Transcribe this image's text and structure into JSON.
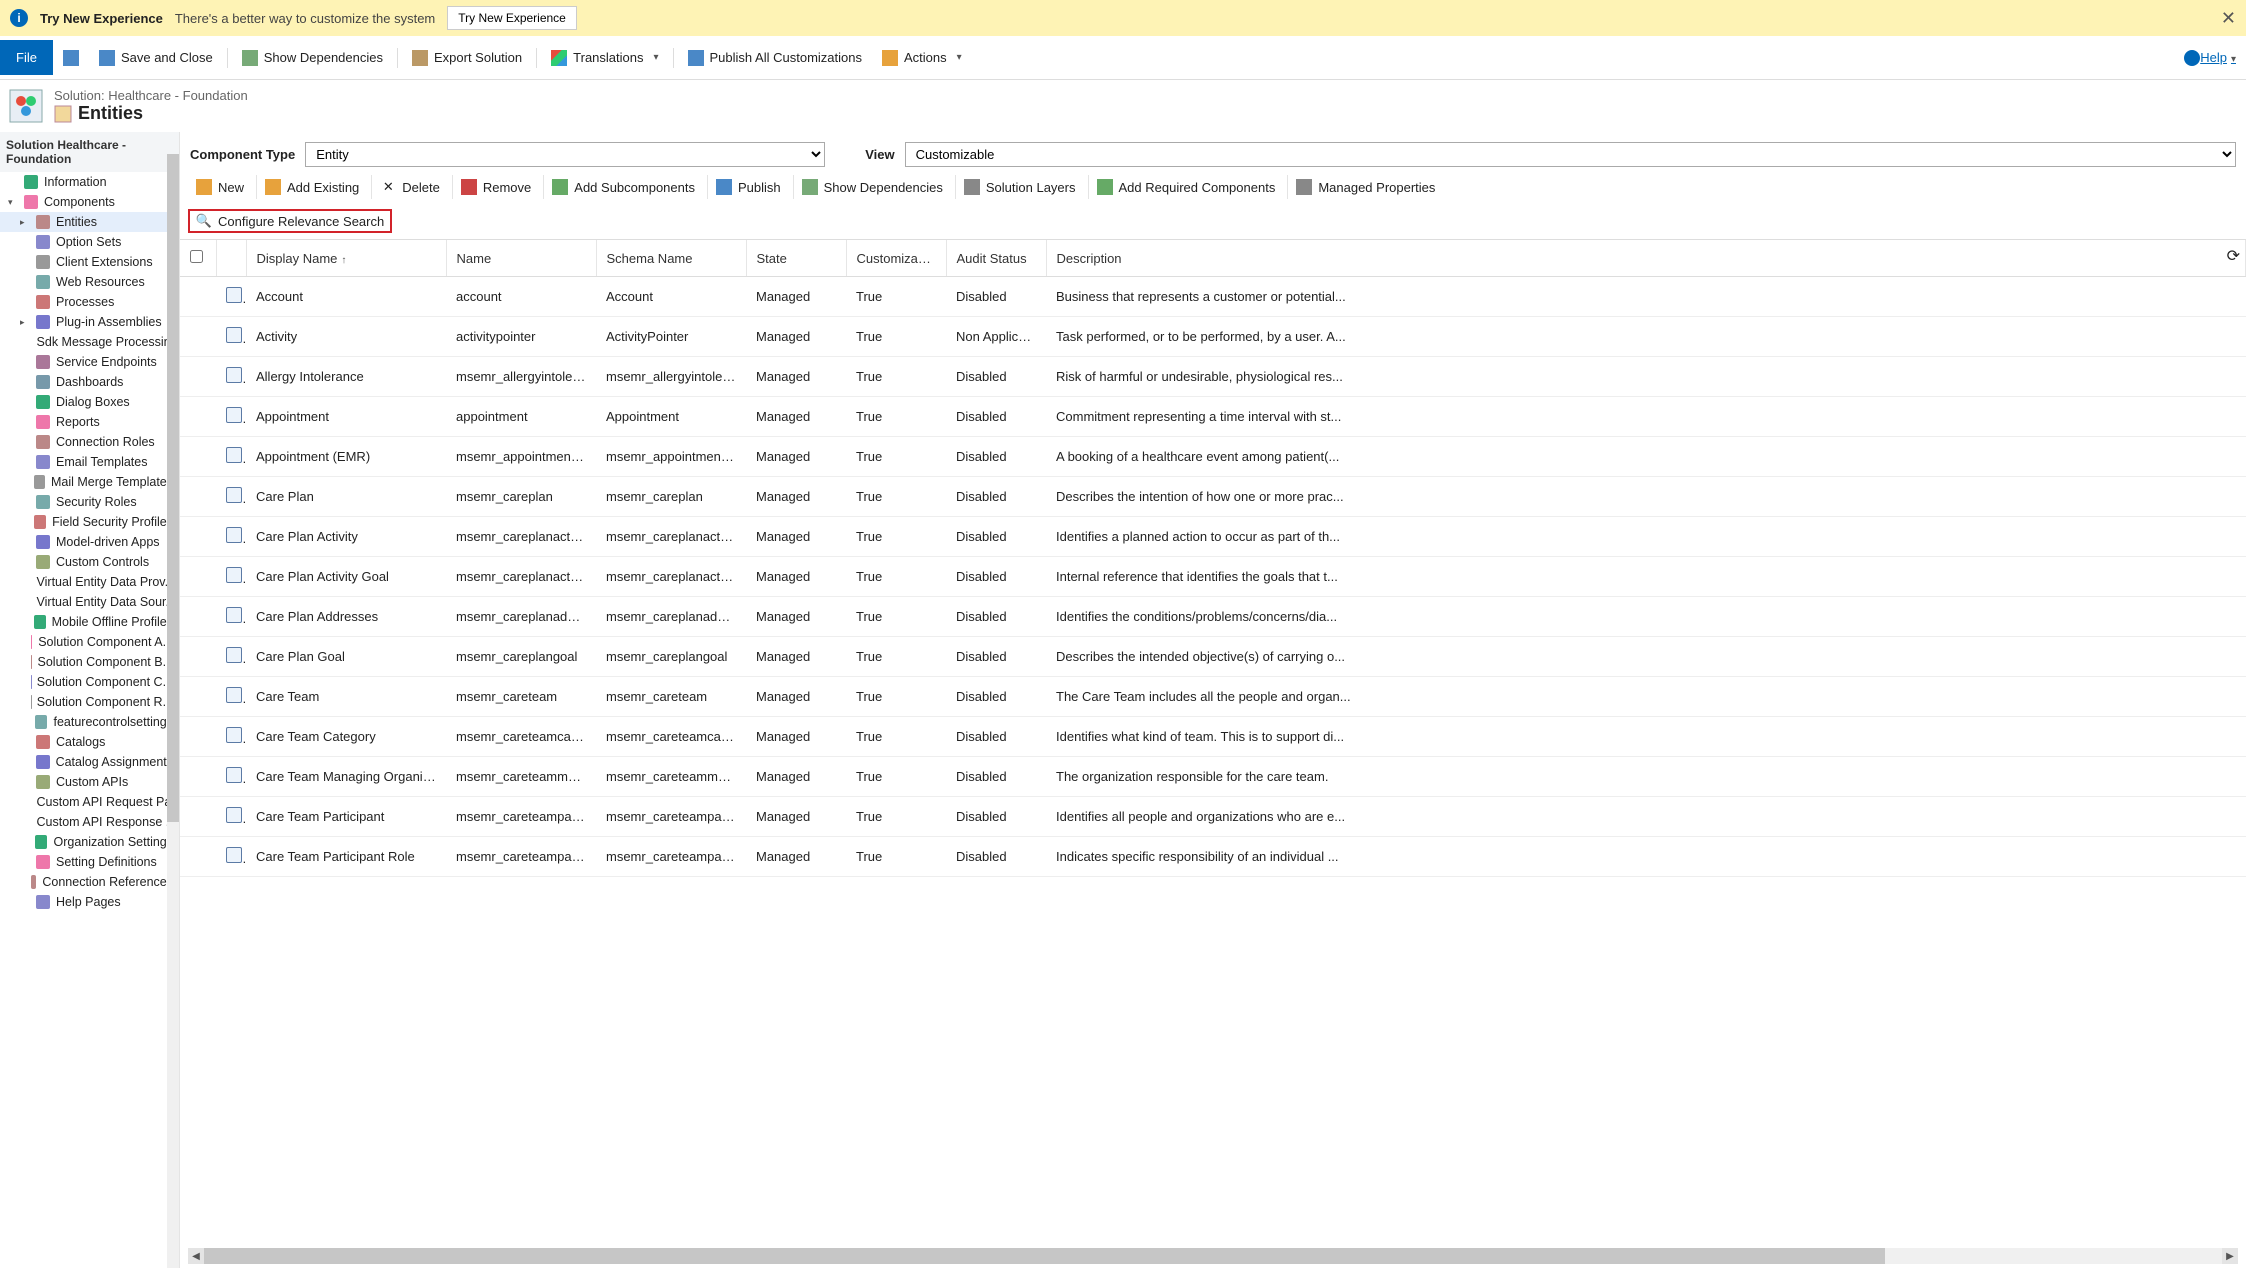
{
  "banner": {
    "title": "Try New Experience",
    "message": "There's a better way to customize the system",
    "button": "Try New Experience"
  },
  "ribbon": {
    "file": "File",
    "save": "",
    "save_close": "Save and Close",
    "show_deps": "Show Dependencies",
    "export_solution": "Export Solution",
    "translations": "Translations",
    "publish_all": "Publish All Customizations",
    "actions": "Actions",
    "help": "Help"
  },
  "header": {
    "solution_line": "Solution: Healthcare - Foundation",
    "entities": "Entities"
  },
  "sidebar": {
    "title": "Solution Healthcare - Foundation",
    "items": [
      {
        "label": "Information",
        "indent": 0,
        "twisty": ""
      },
      {
        "label": "Components",
        "indent": 0,
        "twisty": "▾"
      },
      {
        "label": "Entities",
        "indent": 1,
        "twisty": "▸",
        "sel": true
      },
      {
        "label": "Option Sets",
        "indent": 1,
        "twisty": ""
      },
      {
        "label": "Client Extensions",
        "indent": 1,
        "twisty": ""
      },
      {
        "label": "Web Resources",
        "indent": 1,
        "twisty": ""
      },
      {
        "label": "Processes",
        "indent": 1,
        "twisty": ""
      },
      {
        "label": "Plug-in Assemblies",
        "indent": 1,
        "twisty": "▸"
      },
      {
        "label": "Sdk Message Processin...",
        "indent": 1,
        "twisty": ""
      },
      {
        "label": "Service Endpoints",
        "indent": 1,
        "twisty": ""
      },
      {
        "label": "Dashboards",
        "indent": 1,
        "twisty": ""
      },
      {
        "label": "Dialog Boxes",
        "indent": 1,
        "twisty": ""
      },
      {
        "label": "Reports",
        "indent": 1,
        "twisty": ""
      },
      {
        "label": "Connection Roles",
        "indent": 1,
        "twisty": ""
      },
      {
        "label": "Email Templates",
        "indent": 1,
        "twisty": ""
      },
      {
        "label": "Mail Merge Templates",
        "indent": 1,
        "twisty": ""
      },
      {
        "label": "Security Roles",
        "indent": 1,
        "twisty": ""
      },
      {
        "label": "Field Security Profiles",
        "indent": 1,
        "twisty": ""
      },
      {
        "label": "Model-driven Apps",
        "indent": 1,
        "twisty": ""
      },
      {
        "label": "Custom Controls",
        "indent": 1,
        "twisty": ""
      },
      {
        "label": "Virtual Entity Data Prov...",
        "indent": 1,
        "twisty": ""
      },
      {
        "label": "Virtual Entity Data Sour...",
        "indent": 1,
        "twisty": ""
      },
      {
        "label": "Mobile Offline Profiles",
        "indent": 1,
        "twisty": ""
      },
      {
        "label": "Solution Component A...",
        "indent": 1,
        "twisty": ""
      },
      {
        "label": "Solution Component B...",
        "indent": 1,
        "twisty": ""
      },
      {
        "label": "Solution Component C...",
        "indent": 1,
        "twisty": ""
      },
      {
        "label": "Solution Component R...",
        "indent": 1,
        "twisty": ""
      },
      {
        "label": "featurecontrolsettings",
        "indent": 1,
        "twisty": ""
      },
      {
        "label": "Catalogs",
        "indent": 1,
        "twisty": ""
      },
      {
        "label": "Catalog Assignments",
        "indent": 1,
        "twisty": ""
      },
      {
        "label": "Custom APIs",
        "indent": 1,
        "twisty": ""
      },
      {
        "label": "Custom API Request Pa...",
        "indent": 1,
        "twisty": ""
      },
      {
        "label": "Custom API Response ...",
        "indent": 1,
        "twisty": ""
      },
      {
        "label": "Organization Settings",
        "indent": 1,
        "twisty": ""
      },
      {
        "label": "Setting Definitions",
        "indent": 1,
        "twisty": ""
      },
      {
        "label": "Connection References",
        "indent": 1,
        "twisty": ""
      },
      {
        "label": "Help Pages",
        "indent": 1,
        "twisty": ""
      }
    ]
  },
  "filters": {
    "component_type_label": "Component Type",
    "component_type_value": "Entity",
    "view_label": "View",
    "view_value": "Customizable"
  },
  "grid_toolbar": {
    "new": "New",
    "add_existing": "Add Existing",
    "delete": "Delete",
    "remove": "Remove",
    "add_subcomponents": "Add Subcomponents",
    "publish": "Publish",
    "show_deps": "Show Dependencies",
    "solution_layers": "Solution Layers",
    "add_required": "Add Required Components",
    "managed_props": "Managed Properties",
    "configure_relevance": "Configure Relevance Search"
  },
  "columns": {
    "display_name": "Display Name",
    "name": "Name",
    "schema_name": "Schema Name",
    "state": "State",
    "customizable": "Customizable...",
    "audit_status": "Audit Status",
    "description": "Description"
  },
  "rows": [
    {
      "display": "Account",
      "name": "account",
      "schema": "Account",
      "state": "Managed",
      "cust": "True",
      "audit": "Disabled",
      "desc": "Business that represents a customer or potential..."
    },
    {
      "display": "Activity",
      "name": "activitypointer",
      "schema": "ActivityPointer",
      "state": "Managed",
      "cust": "True",
      "audit": "Non Applicable",
      "desc": "Task performed, or to be performed, by a user. A..."
    },
    {
      "display": "Allergy Intolerance",
      "name": "msemr_allergyintolera...",
      "schema": "msemr_allergyintolera...",
      "state": "Managed",
      "cust": "True",
      "audit": "Disabled",
      "desc": "Risk of harmful or undesirable, physiological res..."
    },
    {
      "display": "Appointment",
      "name": "appointment",
      "schema": "Appointment",
      "state": "Managed",
      "cust": "True",
      "audit": "Disabled",
      "desc": "Commitment representing a time interval with st..."
    },
    {
      "display": "Appointment (EMR)",
      "name": "msemr_appointmente...",
      "schema": "msemr_appointmente...",
      "state": "Managed",
      "cust": "True",
      "audit": "Disabled",
      "desc": "A booking of a healthcare event among patient(..."
    },
    {
      "display": "Care Plan",
      "name": "msemr_careplan",
      "schema": "msemr_careplan",
      "state": "Managed",
      "cust": "True",
      "audit": "Disabled",
      "desc": "Describes the intention of how one or more prac..."
    },
    {
      "display": "Care Plan Activity",
      "name": "msemr_careplanactivity",
      "schema": "msemr_careplanactivity",
      "state": "Managed",
      "cust": "True",
      "audit": "Disabled",
      "desc": "Identifies a planned action to occur as part of th..."
    },
    {
      "display": "Care Plan Activity Goal",
      "name": "msemr_careplanactivit...",
      "schema": "msemr_careplanactivit...",
      "state": "Managed",
      "cust": "True",
      "audit": "Disabled",
      "desc": "Internal reference that identifies the goals that t..."
    },
    {
      "display": "Care Plan Addresses",
      "name": "msemr_careplanaddre...",
      "schema": "msemr_careplanaddre...",
      "state": "Managed",
      "cust": "True",
      "audit": "Disabled",
      "desc": "Identifies the conditions/problems/concerns/dia..."
    },
    {
      "display": "Care Plan Goal",
      "name": "msemr_careplangoal",
      "schema": "msemr_careplangoal",
      "state": "Managed",
      "cust": "True",
      "audit": "Disabled",
      "desc": "Describes the intended objective(s) of carrying o..."
    },
    {
      "display": "Care Team",
      "name": "msemr_careteam",
      "schema": "msemr_careteam",
      "state": "Managed",
      "cust": "True",
      "audit": "Disabled",
      "desc": "The Care Team includes all the people and organ..."
    },
    {
      "display": "Care Team Category",
      "name": "msemr_careteamcateg...",
      "schema": "msemr_careteamcateg...",
      "state": "Managed",
      "cust": "True",
      "audit": "Disabled",
      "desc": "Identifies what kind of team. This is to support di..."
    },
    {
      "display": "Care Team Managing Organiza...",
      "name": "msemr_careteammana...",
      "schema": "msemr_careteammana...",
      "state": "Managed",
      "cust": "True",
      "audit": "Disabled",
      "desc": "The organization responsible for the care team."
    },
    {
      "display": "Care Team Participant",
      "name": "msemr_careteamparti...",
      "schema": "msemr_careteamparti...",
      "state": "Managed",
      "cust": "True",
      "audit": "Disabled",
      "desc": "Identifies all people and organizations who are e..."
    },
    {
      "display": "Care Team Participant Role",
      "name": "msemr_careteamparti...",
      "schema": "msemr_careteamparti...",
      "state": "Managed",
      "cust": "True",
      "audit": "Disabled",
      "desc": "Indicates specific responsibility of an individual ..."
    }
  ]
}
